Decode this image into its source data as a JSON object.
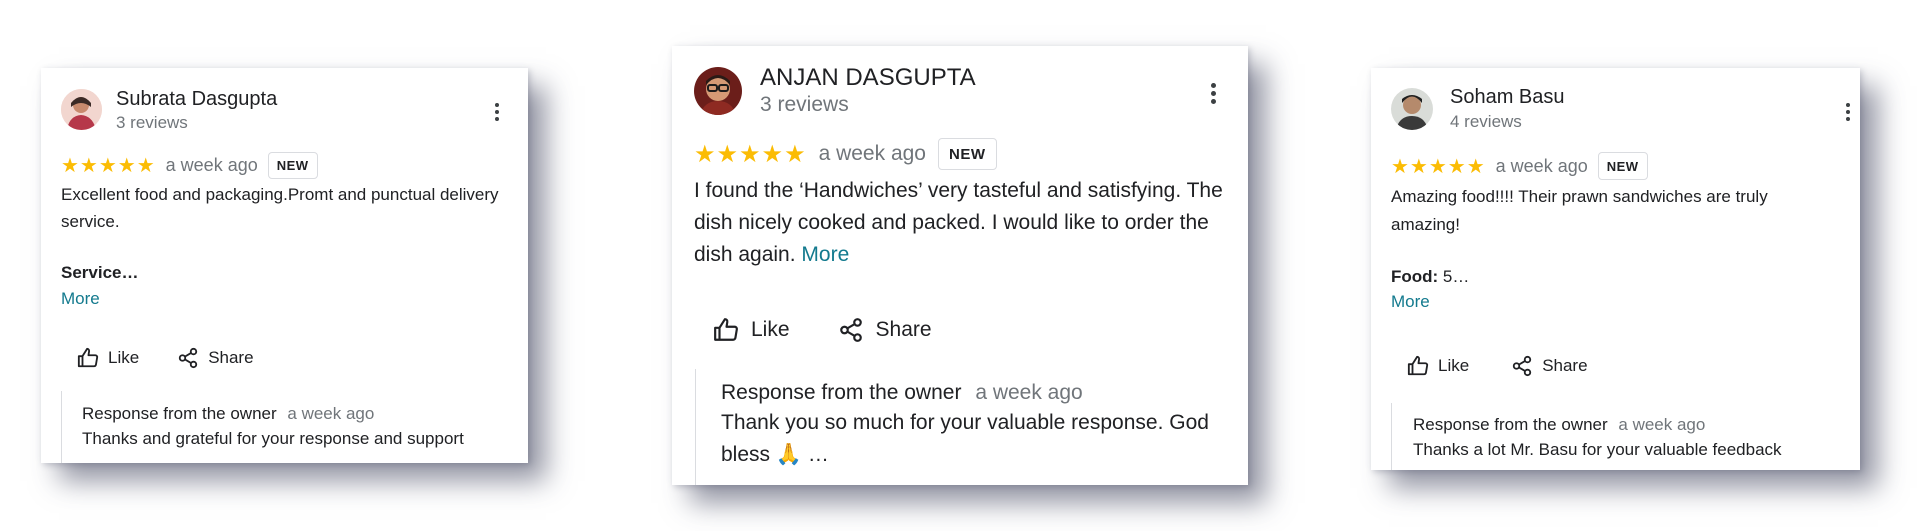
{
  "colors": {
    "star": "#fbbc04",
    "link": "#137a8e",
    "muted": "#70757a",
    "text": "#202124"
  },
  "reviews": [
    {
      "name": "Subrata Dasgupta",
      "review_count": "3 reviews",
      "stars": "★★★★★",
      "date": "a week ago",
      "badge": "NEW",
      "text": "Excellent food and packaging.Promt and punctual delivery service.",
      "bold_label": "Service…",
      "bold_value": "",
      "more": "More",
      "like": "Like",
      "share": "Share",
      "response_title": "Response from the owner",
      "response_date": "a week ago",
      "response_text": "Thanks and grateful for your response and support"
    },
    {
      "name": "ANJAN DASGUPTA",
      "review_count": "3 reviews",
      "stars": "★★★★★",
      "date": "a week ago",
      "badge": "NEW",
      "text": "I found the ‘Handwiches’ very tasteful and satisfying. The dish nicely cooked and packed. I would like to order the dish again.",
      "more": "More",
      "like": "Like",
      "share": "Share",
      "response_title": "Response from the owner",
      "response_date": "a week ago",
      "response_text": "Thank you so much for your valuable response. God bless 🙏 …"
    },
    {
      "name": "Soham Basu",
      "review_count": "4 reviews",
      "stars": "★★★★★",
      "date": "a week ago",
      "badge": "NEW",
      "text": "Amazing food!!!! Their prawn sandwiches are truly amazing!",
      "bold_label": "Food:",
      "bold_value": " 5…",
      "more": "More",
      "like": "Like",
      "share": "Share",
      "response_title": "Response from the owner",
      "response_date": "a week ago",
      "response_text": "Thanks a lot Mr. Basu for your valuable feedback"
    }
  ]
}
